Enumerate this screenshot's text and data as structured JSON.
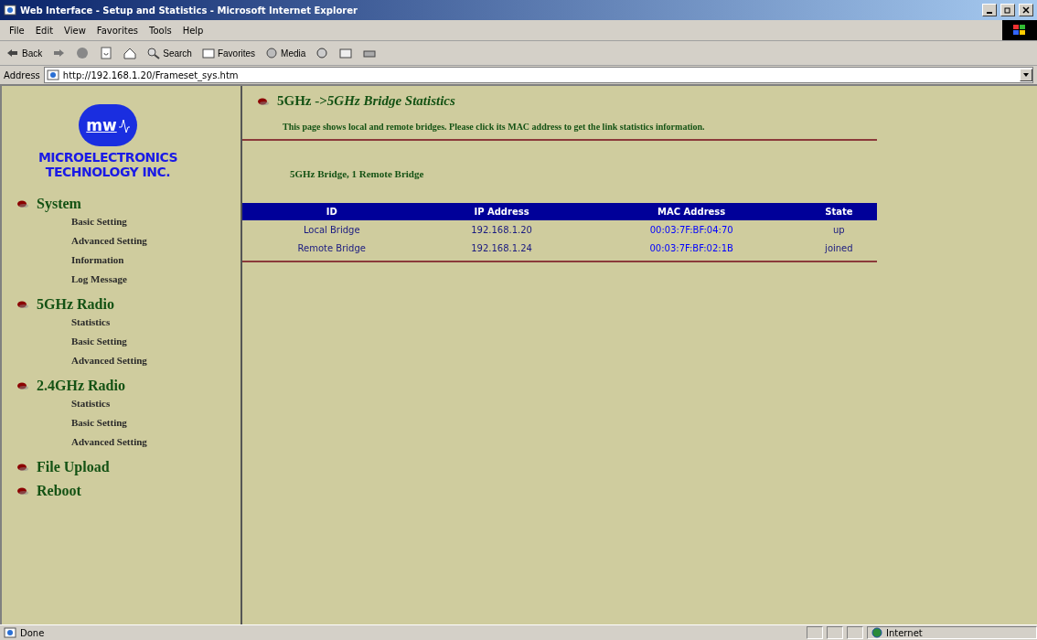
{
  "window": {
    "title": "Web Interface - Setup and Statistics - Microsoft Internet Explorer"
  },
  "menu": [
    "File",
    "Edit",
    "View",
    "Favorites",
    "Tools",
    "Help"
  ],
  "toolbar": [
    {
      "kind": "back",
      "label": "Back"
    },
    {
      "kind": "forward"
    },
    {
      "kind": "stop"
    },
    {
      "kind": "refresh"
    },
    {
      "kind": "home"
    },
    {
      "kind": "search",
      "label": "Search"
    },
    {
      "kind": "favorites",
      "label": "Favorites"
    },
    {
      "kind": "media",
      "label": "Media"
    },
    {
      "kind": "history"
    },
    {
      "kind": "mail"
    },
    {
      "kind": "print"
    }
  ],
  "address": {
    "label": "Address",
    "value": "http://192.168.1.20/Frameset_sys.htm"
  },
  "logo": {
    "mark": "mw",
    "line_1": "MICROELECTRONICS",
    "line_2": "TECHNOLOGY INC."
  },
  "sidebar": {
    "sections": [
      {
        "label": "System",
        "children": [
          "Basic Setting",
          "Advanced Setting",
          "Information",
          "Log Message"
        ]
      },
      {
        "label": "5GHz Radio",
        "children": [
          "Statistics",
          "Basic Setting",
          "Advanced Setting"
        ]
      },
      {
        "label": "2.4GHz Radio",
        "children": [
          "Statistics",
          "Basic Setting",
          "Advanced Setting"
        ]
      },
      {
        "label": "File Upload"
      },
      {
        "label": "Reboot"
      }
    ]
  },
  "page": {
    "title": "5GHz ->*5GHz Bridge Statistics*",
    "intro": "This page shows local and remote bridges. Please click its MAC address to get the link statistics information.",
    "summary": "5GHz Bridge, 1 Remote Bridge"
  },
  "table": {
    "columns": [
      "ID",
      "IP Address",
      "MAC Address",
      "State"
    ],
    "rows": [
      [
        "Local Bridge",
        "192.168.1.20",
        "00:03:7F:BF:04:70",
        "up"
      ],
      [
        "Remote Bridge",
        "192.168.1.24",
        "00:03:7F:BF:02:1B",
        "joined"
      ]
    ]
  },
  "status_bar": {
    "text": "Done",
    "zone": "Internet"
  }
}
